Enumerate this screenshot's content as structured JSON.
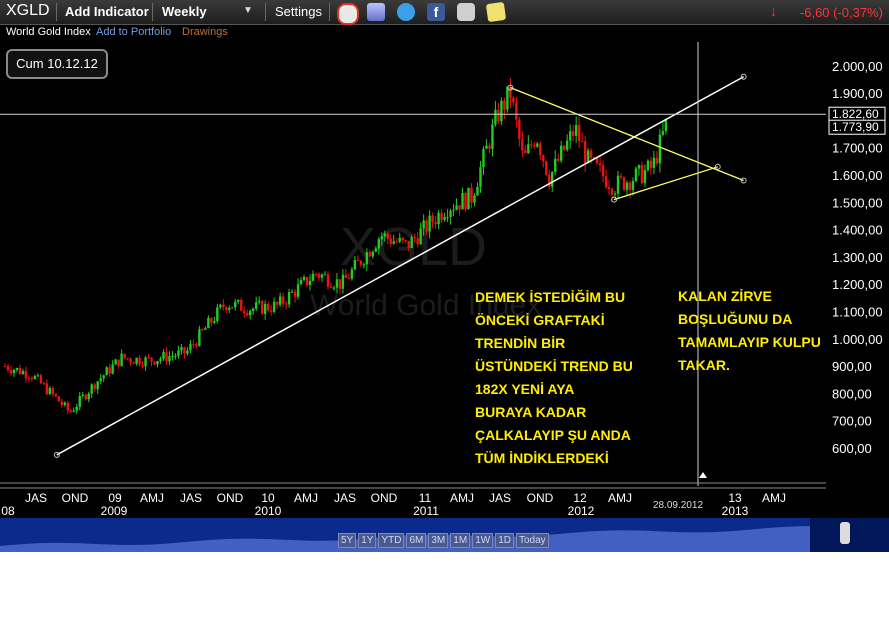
{
  "toolbar": {
    "symbol": "XGLD",
    "add_indicator": "Add Indicator",
    "interval": "Weekly",
    "settings": "Settings",
    "change": "-6,60 (-0,37%)",
    "change_color": "#ff3333"
  },
  "subbar": {
    "index_name": "World Gold Index",
    "add_portfolio": "Add to Portfolio",
    "drawings": "Drawings"
  },
  "date_box": "Cum 10.12.12",
  "watermark": {
    "symbol": "XGLD",
    "name": "World Gold Index"
  },
  "annotations": {
    "left": "DEMEK İSTEDİĞİM BU\nÖNCEKİ GRAFTAKİ\nTRENDİN BİR\nÜSTÜNDEKİ TREND BU\n182X YENİ AYA\nBURAYA KADAR\nÇALKALAYIP ŞU ANDA\nTÜM İNDİKLERDEKİ",
    "right": "KALAN ZİRVE\nBOŞLUĞUNU DA\nTAMAMLAYIP KULPU\nTAKAR.",
    "color": "#ffee00"
  },
  "range_buttons": [
    "5Y",
    "1Y",
    "YTD",
    "6M",
    "3M",
    "1M",
    "1W",
    "1D",
    "Today"
  ],
  "chart_data": {
    "type": "candlestick",
    "y_ticks": [
      "2.000,00",
      "1.900,00",
      "1.800,00",
      "1.700,00",
      "1.600,00",
      "1.500,00",
      "1.400,00",
      "1.300,00",
      "1.200,00",
      "1.100,00",
      "1.000,00",
      "900,00",
      "800,00",
      "700,00",
      "600,00"
    ],
    "ylim": [
      550,
      2050
    ],
    "price_labels": [
      "1.822,60",
      "1.773,90"
    ],
    "x_month_labels": [
      "JAS",
      "OND",
      "09",
      "AMJ",
      "JAS",
      "OND",
      "10",
      "AMJ",
      "JAS",
      "OND",
      "11",
      "AMJ",
      "JAS",
      "OND",
      "12",
      "AMJ",
      "13",
      "AMJ"
    ],
    "x_year_labels": [
      "08",
      "2009",
      "2010",
      "2011",
      "2012",
      "2013"
    ],
    "crosshair_date": "28.09.2012",
    "colors": {
      "up": "#22cc22",
      "down": "#ee1111",
      "trend": "#ffffff",
      "triangle": "#ffff66"
    },
    "trendline": [
      {
        "date": "2008-10",
        "value": 575
      },
      {
        "date": "2013-03",
        "value": 1960
      }
    ],
    "triangle_upper": [
      {
        "date": "2011-09",
        "value": 1920
      },
      {
        "date": "2013-03",
        "value": 1580
      }
    ],
    "triangle_lower": [
      {
        "date": "2012-05",
        "value": 1510
      },
      {
        "date": "2013-01",
        "value": 1630
      }
    ],
    "price_path": [
      {
        "date": "2008-06",
        "value": 900
      },
      {
        "date": "2008-08",
        "value": 870
      },
      {
        "date": "2008-10",
        "value": 780
      },
      {
        "date": "2008-11",
        "value": 730
      },
      {
        "date": "2009-01",
        "value": 840
      },
      {
        "date": "2009-03",
        "value": 930
      },
      {
        "date": "2009-05",
        "value": 920
      },
      {
        "date": "2009-08",
        "value": 950
      },
      {
        "date": "2009-11",
        "value": 1130
      },
      {
        "date": "2010-01",
        "value": 1110
      },
      {
        "date": "2010-03",
        "value": 1120
      },
      {
        "date": "2010-06",
        "value": 1240
      },
      {
        "date": "2010-08",
        "value": 1200
      },
      {
        "date": "2010-11",
        "value": 1380
      },
      {
        "date": "2011-01",
        "value": 1340
      },
      {
        "date": "2011-04",
        "value": 1480
      },
      {
        "date": "2011-06",
        "value": 1520
      },
      {
        "date": "2011-08",
        "value": 1820
      },
      {
        "date": "2011-09",
        "value": 1900
      },
      {
        "date": "2011-10",
        "value": 1650
      },
      {
        "date": "2011-11",
        "value": 1750
      },
      {
        "date": "2011-12",
        "value": 1590
      },
      {
        "date": "2012-02",
        "value": 1770
      },
      {
        "date": "2012-03",
        "value": 1650
      },
      {
        "date": "2012-05",
        "value": 1560
      },
      {
        "date": "2012-07",
        "value": 1600
      },
      {
        "date": "2012-08",
        "value": 1630
      },
      {
        "date": "2012-09",
        "value": 1780
      }
    ]
  }
}
